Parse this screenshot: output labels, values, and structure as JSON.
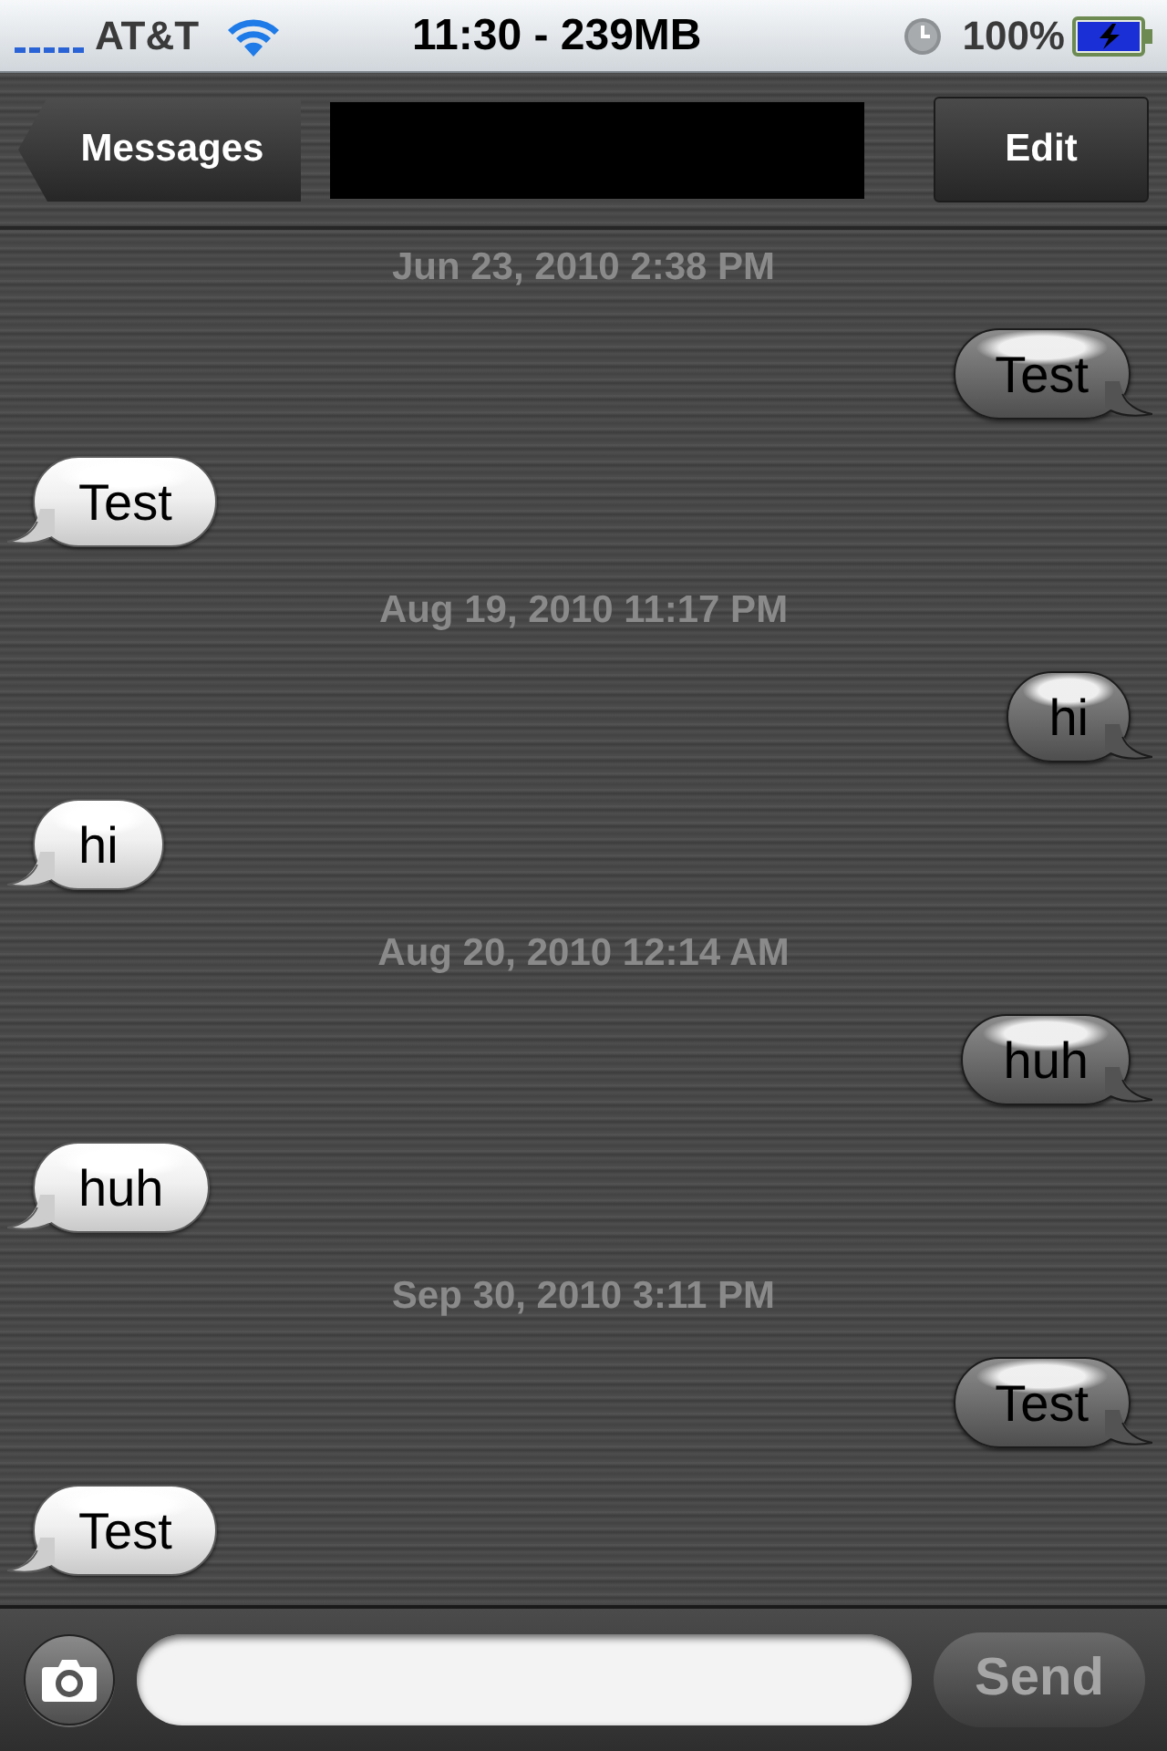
{
  "status_bar": {
    "carrier": "AT&T",
    "time": "11:30 - 239MB",
    "battery": "100%"
  },
  "nav_bar": {
    "back_button": "Messages",
    "edit_button": "Edit"
  },
  "conversation": [
    {
      "timestamp": "Jun 23, 2010 2:38 PM",
      "messages": [
        {
          "kind": "sent",
          "text": "Test"
        },
        {
          "kind": "received",
          "text": "Test"
        }
      ]
    },
    {
      "timestamp": "Aug 19, 2010 11:17 PM",
      "messages": [
        {
          "kind": "sent",
          "text": "hi"
        },
        {
          "kind": "received",
          "text": "hi"
        }
      ]
    },
    {
      "timestamp": "Aug 20, 2010 12:14 AM",
      "messages": [
        {
          "kind": "sent",
          "text": "huh"
        },
        {
          "kind": "received",
          "text": "huh"
        }
      ]
    },
    {
      "timestamp": "Sep 30, 2010 3:11 PM",
      "messages": [
        {
          "kind": "sent",
          "text": "Test"
        },
        {
          "kind": "received",
          "text": "Test"
        }
      ]
    }
  ],
  "compose_bar": {
    "send_button": {
      "label": "Send",
      "disabled": true
    }
  }
}
